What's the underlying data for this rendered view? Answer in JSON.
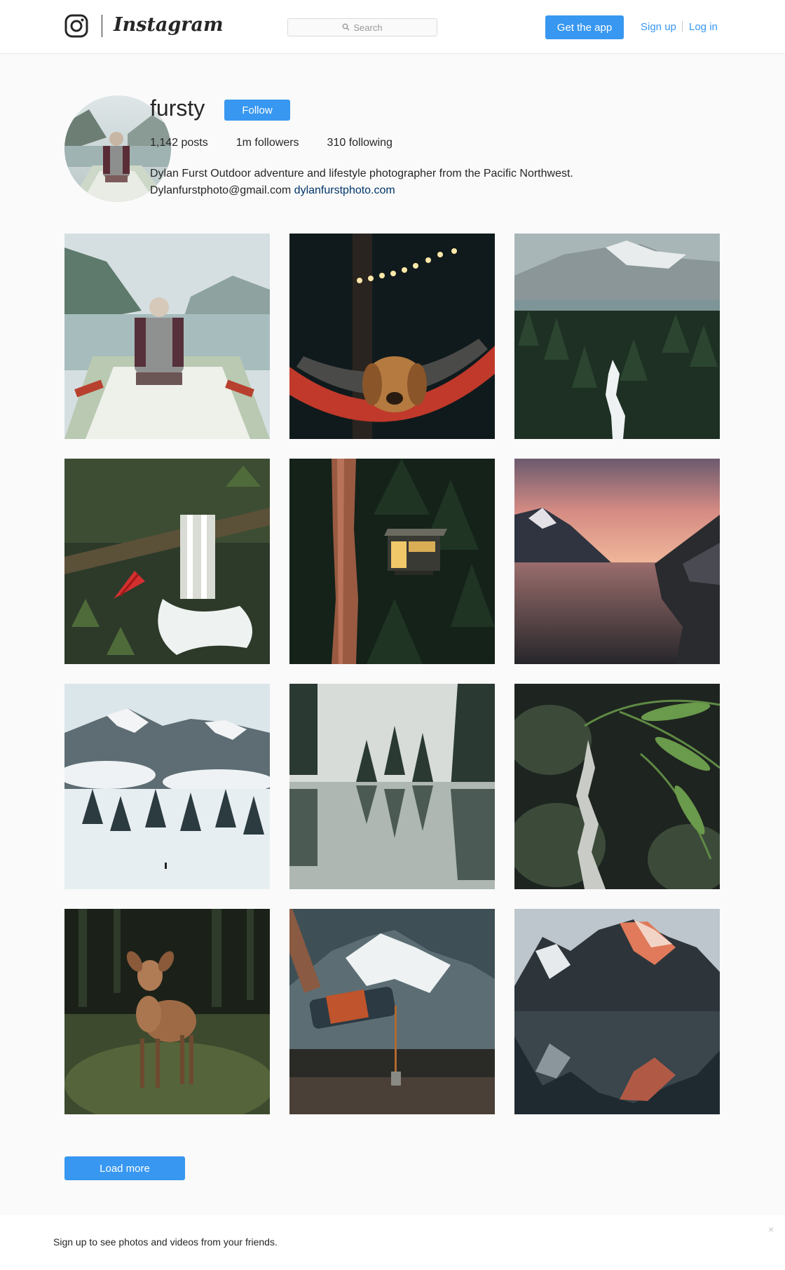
{
  "header": {
    "brand": "Instagram",
    "search_placeholder": "Search",
    "get_app_label": "Get the app",
    "signup_label": "Sign up",
    "login_label": "Log in"
  },
  "profile": {
    "username": "fursty",
    "follow_label": "Follow",
    "stats": {
      "posts": "1,142 posts",
      "followers": "1m followers",
      "following": "310 following"
    },
    "bio_line1": "Dylan Furst Outdoor adventure and lifestyle photographer from the Pacific Northwest.",
    "email": "Dylanfurstphoto@gmail.com",
    "website": "dylanfurstphoto.com"
  },
  "grid": {
    "photos": [
      "boat-lake",
      "dog-hammock",
      "waterfall-forest",
      "stream-hammock",
      "cabin-forest",
      "sunset-lake",
      "snowy-mountains",
      "misty-lake",
      "fern-creek",
      "deer-forest",
      "pour-mountain",
      "mountain-reflection"
    ]
  },
  "load_more_label": "Load more",
  "banner": {
    "text": "Sign up to see photos and videos from your friends.",
    "close_glyph": "×"
  },
  "colors": {
    "accent": "#3897f0",
    "link_dark": "#003569",
    "background": "#fafafa"
  }
}
